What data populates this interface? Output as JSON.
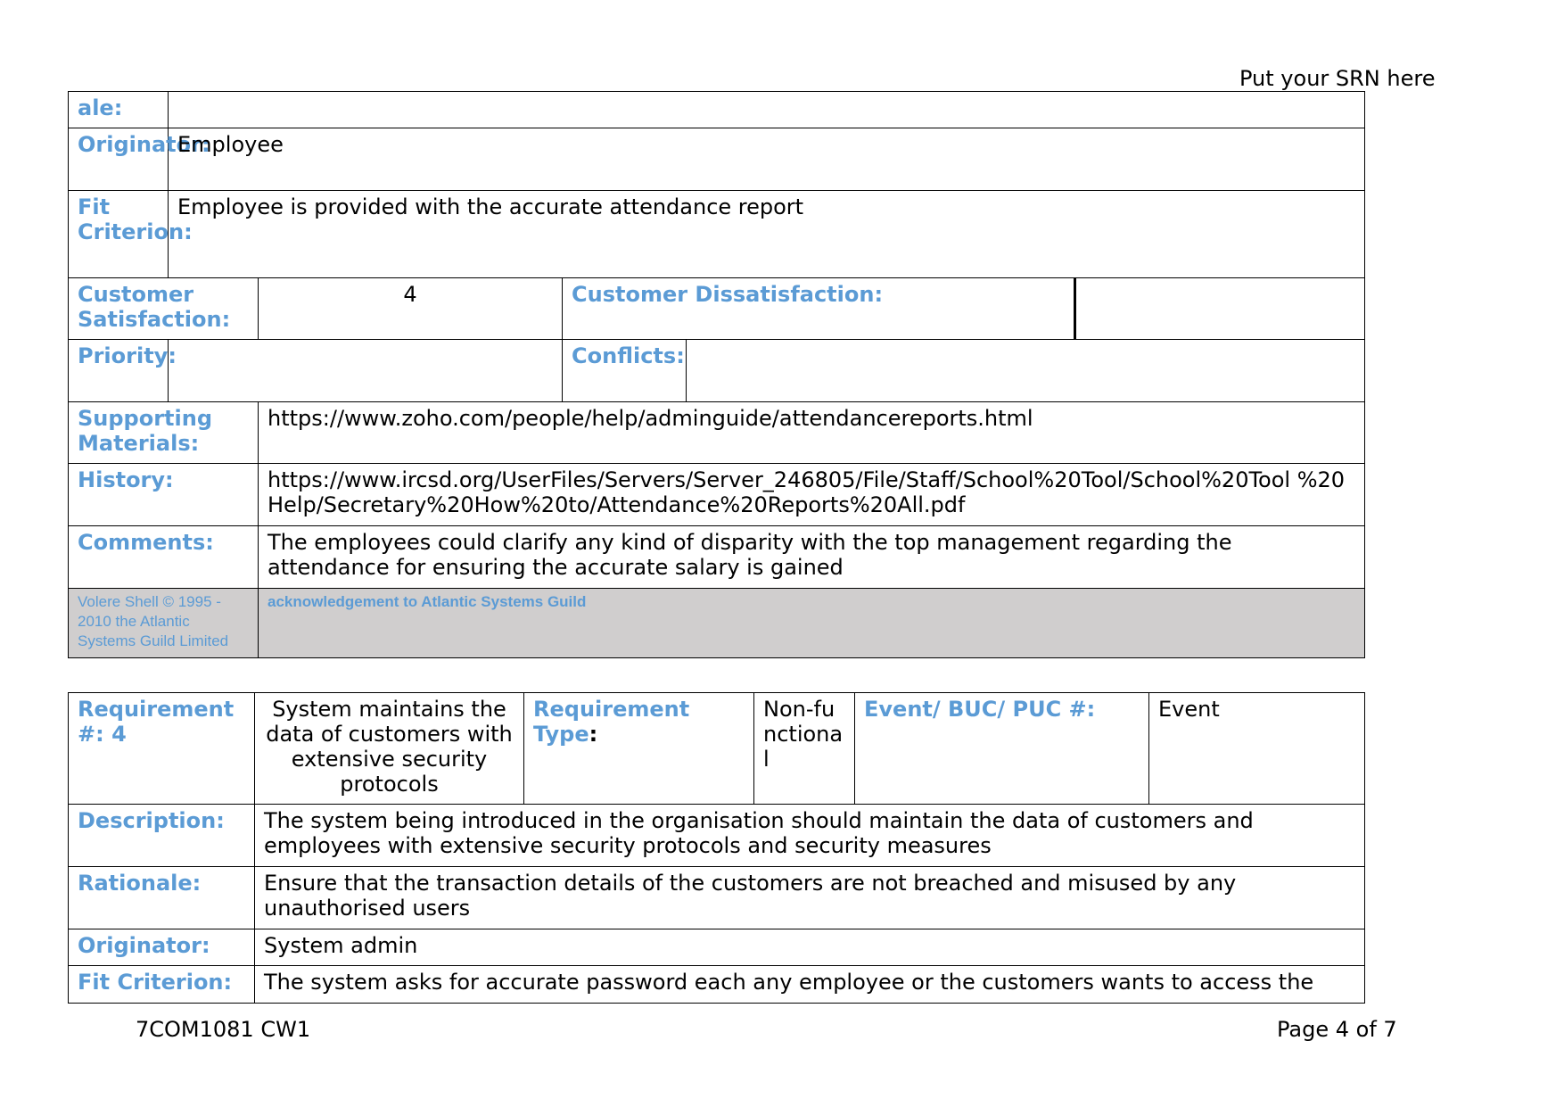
{
  "header": {
    "srn_placeholder": "Put your SRN here"
  },
  "table1": {
    "rationale_label_fragment": "ale:",
    "rationale_value": "",
    "originator_label": "Originator:",
    "originator_value": "Employee",
    "fit_criterion_label": "Fit Criterion:",
    "fit_criterion_value": "Employee is provided with the accurate attendance report",
    "customer_satisfaction_label": "Customer Satisfaction:",
    "customer_satisfaction_value": "4",
    "customer_dissatisfaction_label": "Customer Dissatisfaction:",
    "customer_dissatisfaction_value": "",
    "priority_label": "Priority:",
    "priority_value": "",
    "conflicts_label": "Conflicts:",
    "conflicts_value": "",
    "supporting_materials_label": "Supporting Materials:",
    "supporting_materials_value": "https://www.zoho.com/people/help/adminguide/attendancereports.html",
    "history_label": "History:",
    "history_value": "https://www.ircsd.org/UserFiles/Servers/Server_246805/File/Staff/School%20Tool/School%20Tool %20Help/Secretary%20How%20to/Attendance%20Reports%20All.pdf",
    "comments_label": "Comments:",
    "comments_value": "The employees could clarify any kind of disparity with the top management regarding the attendance for ensuring the accurate salary is gained",
    "copyright": "Volere Shell © 1995 - 2010 the Atlantic Systems Guild Limited",
    "acknowledgement": "acknowledgement to Atlantic Systems Guild"
  },
  "table2": {
    "requirement_number_label": "Requirement #: 4",
    "requirement_title": "System maintains the data of customers with extensive security protocols",
    "requirement_type_label": "Requirement Type",
    "requirement_type_colon": ":",
    "requirement_type_value": "Non-functional",
    "event_label": "Event/ BUC/ PUC #:",
    "event_value": "Event",
    "description_label": "Description:",
    "description_value": "The system being introduced in the organisation should maintain the data of customers and employees with extensive security protocols and security measures",
    "rationale_label": "Rationale:",
    "rationale_value": "Ensure that the transaction details of the customers are not breached and misused by any unauthorised users",
    "originator_label": "Originator:",
    "originator_value": "System admin",
    "fit_criterion_label": "Fit Criterion:",
    "fit_criterion_value": "The system asks for accurate password each any employee or the customers wants to access the"
  },
  "footer": {
    "course_code": "7COM1081 CW1",
    "page_number": "Page 4 of 7"
  }
}
